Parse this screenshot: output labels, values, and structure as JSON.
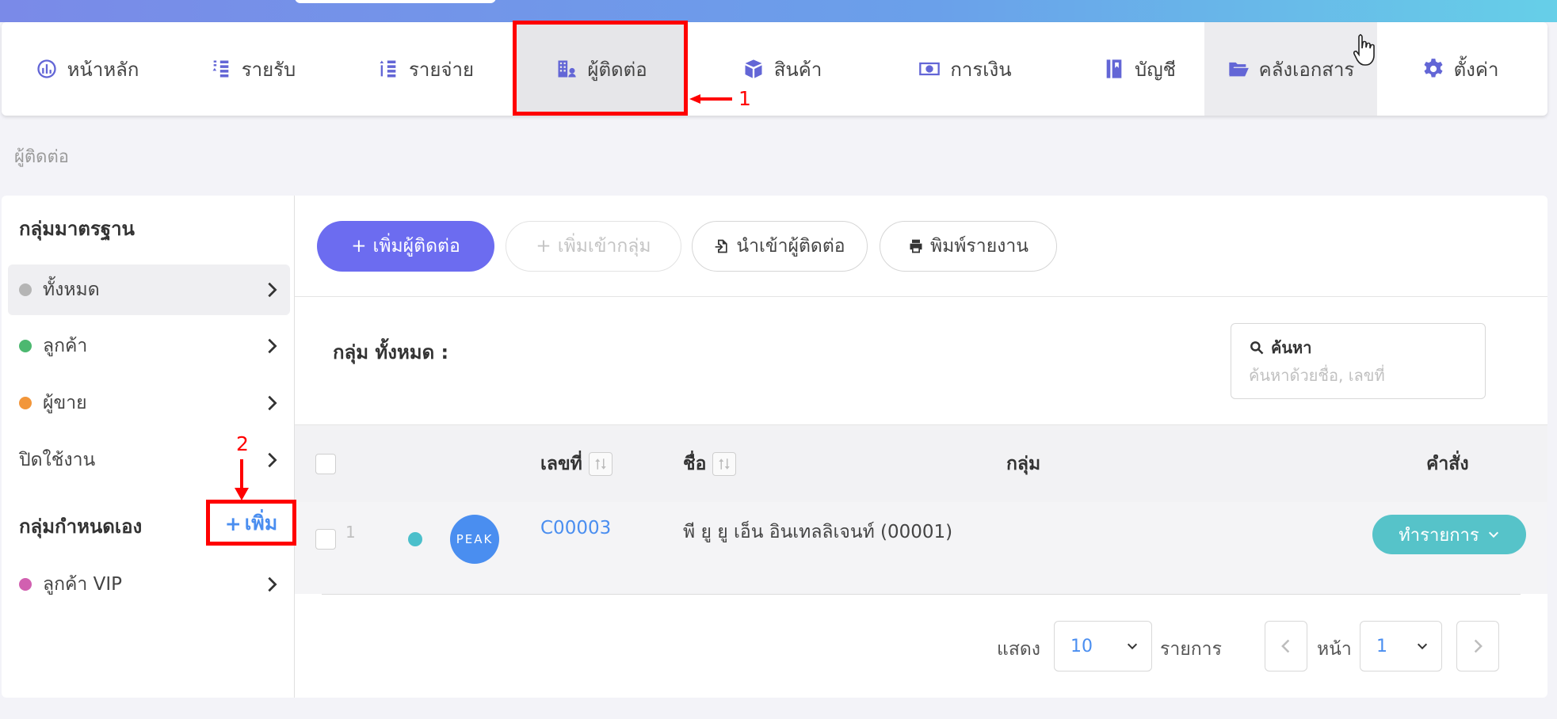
{
  "nav": {
    "items": [
      {
        "label": "หน้าหลัก",
        "icon": "dashboard-icon"
      },
      {
        "label": "รายรับ",
        "icon": "income-icon"
      },
      {
        "label": "รายจ่าย",
        "icon": "expense-icon"
      },
      {
        "label": "ผู้ติดต่อ",
        "icon": "contacts-icon"
      },
      {
        "label": "สินค้า",
        "icon": "product-box-icon"
      },
      {
        "label": "การเงิน",
        "icon": "money-icon"
      },
      {
        "label": "บัญชี",
        "icon": "ledger-book-icon"
      },
      {
        "label": "คลังเอกสาร",
        "icon": "folder-icon"
      },
      {
        "label": "ตั้งค่า",
        "icon": "gear-icon"
      }
    ],
    "active_index": 3,
    "hover_index": 7
  },
  "breadcrumb": "ผู้ติดต่อ",
  "sidebar": {
    "standard_groups_title": "กลุ่มมาตรฐาน",
    "standard_groups": [
      {
        "label": "ทั้งหมด",
        "color": "#b5b5b5",
        "selected": true
      },
      {
        "label": "ลูกค้า",
        "color": "#4cb870",
        "selected": false
      },
      {
        "label": "ผู้ขาย",
        "color": "#f2963a",
        "selected": false
      },
      {
        "label": "ปิดใช้งาน",
        "color": "",
        "selected": false
      }
    ],
    "custom_groups_title": "กลุ่มกำหนดเอง",
    "add_label": "เพิ่ม",
    "custom_groups": [
      {
        "label": "ลูกค้า VIP",
        "color": "#d160b0"
      }
    ]
  },
  "toolbar": {
    "add_contact": "เพิ่มผู้ติดต่อ",
    "add_to_group": "เพิ่มเข้ากลุ่ม",
    "import_contacts": "นำเข้าผู้ติดต่อ",
    "print_report": "พิมพ์รายงาน"
  },
  "list": {
    "group_title": "กลุ่ม ทั้งหมด :",
    "search_label": "ค้นหา",
    "search_placeholder": "ค้นหาด้วยชื่อ, เลขที่",
    "columns": {
      "number": "เลขที่",
      "name": "ชื่อ",
      "group": "กลุ่ม",
      "actions": "คำสั่ง"
    },
    "rows": [
      {
        "index": "1",
        "code": "C00003",
        "name": "พี ยู ยู เอ็น อินเทลลิเจนท์ (00001)",
        "avatar_text": "PEAK",
        "action_label": "ทำรายการ"
      }
    ]
  },
  "pagination": {
    "show_label": "แสดง",
    "per_page": "10",
    "items_label": "รายการ",
    "page_label": "หน้า",
    "page": "1"
  },
  "annotations": {
    "step1": "1",
    "step2": "2",
    "color": "#ff0000"
  }
}
